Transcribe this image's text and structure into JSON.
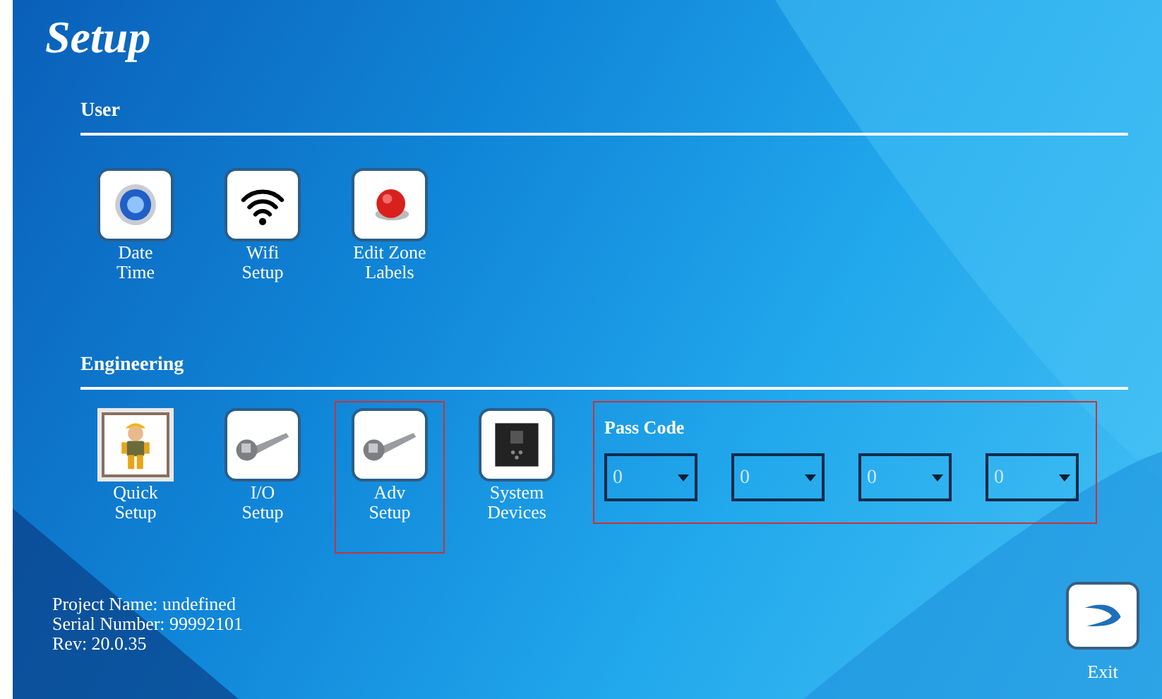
{
  "title": "Setup",
  "sections": [
    {
      "heading": "User",
      "items": [
        {
          "kind": "clock",
          "label": "Date\nTime",
          "selected": false,
          "highlighted": false
        },
        {
          "kind": "wifi",
          "label": "Wifi\nSetup",
          "selected": false,
          "highlighted": false
        },
        {
          "kind": "alarm",
          "label": "Edit Zone\nLabels",
          "selected": false,
          "highlighted": false
        }
      ]
    },
    {
      "heading": "Engineering",
      "items": [
        {
          "kind": "worker",
          "label": "Quick\nSetup",
          "selected": true,
          "highlighted": false
        },
        {
          "kind": "wrench",
          "label": "I/O\nSetup",
          "selected": false,
          "highlighted": false
        },
        {
          "kind": "wrench",
          "label": "Adv\nSetup",
          "selected": false,
          "highlighted": true
        },
        {
          "kind": "panel",
          "label": "System\nDevices",
          "selected": false,
          "highlighted": false
        }
      ],
      "pass_code": {
        "label": "Pass Code",
        "highlighted": true,
        "digits": [
          "0",
          "0",
          "0",
          "0"
        ]
      }
    }
  ],
  "info": [
    "Project Name: undefined",
    "Serial Number: 99992101",
    "Rev: 20.0.35"
  ],
  "exit": {
    "label": "Exit"
  }
}
